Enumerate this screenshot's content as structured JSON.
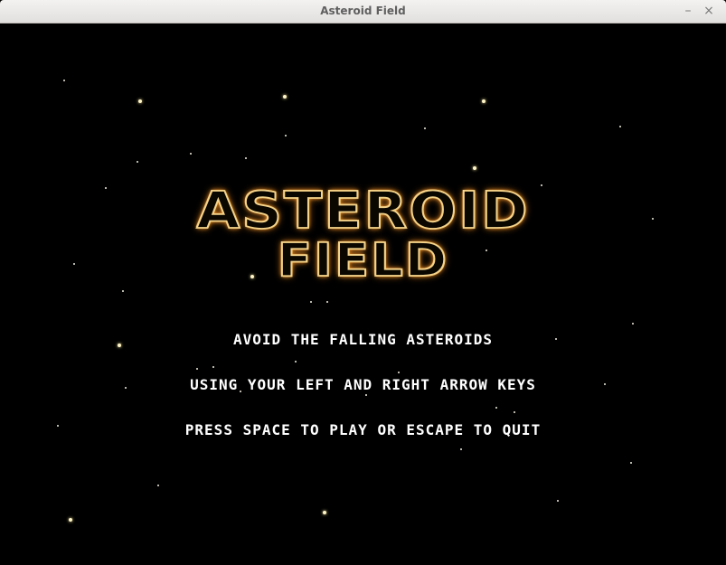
{
  "window": {
    "title": "Asteroid Field",
    "minimize_glyph": "–",
    "close_glyph": "×"
  },
  "game": {
    "logo_line1": "ASTEROID",
    "logo_line2": "FIELD",
    "instructions": [
      "AVOID THE FALLING ASTEROIDS",
      "USING YOUR LEFT AND RIGHT ARROW KEYS",
      "PRESS SPACE TO PLAY OR ESCAPE TO QUIT"
    ],
    "colors": {
      "background": "#000000",
      "logo_outline": "#f5d48a",
      "logo_glow": "#ff9a2a",
      "text": "#ffffff"
    }
  }
}
